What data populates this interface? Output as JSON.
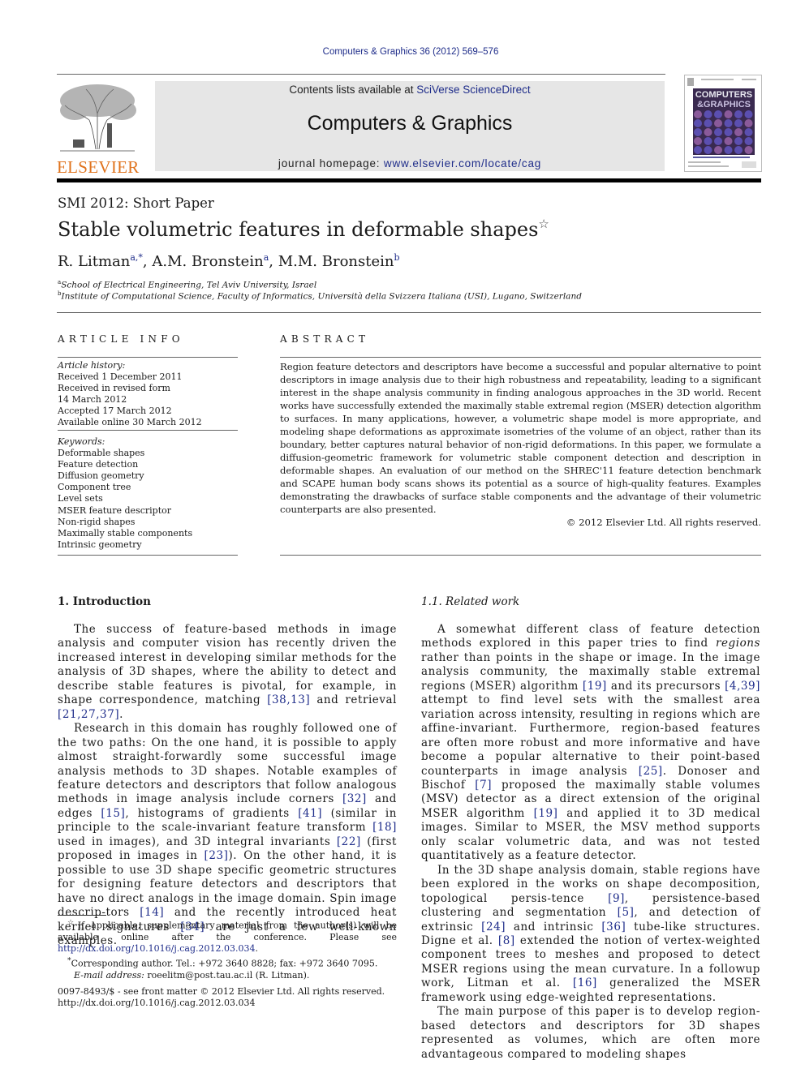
{
  "header": {
    "journal_ref": "Computers & Graphics 36 (2012) 569–576",
    "contents_prefix": "Contents lists available at ",
    "contents_link": "SciVerse ScienceDirect",
    "journal_title": "Computers & Graphics",
    "homepage_prefix": "journal homepage: ",
    "homepage_link": "www.elsevier.com/locate/cag",
    "publisher_logo_text": "ELSEVIER",
    "cover_title_line1": "COMPUTERS",
    "cover_title_line2": "&GRAPHICS",
    "colors": {
      "link": "#1f2d8a",
      "elsevier_orange": "#e0731d",
      "banner_bg": "#e6e6e6"
    }
  },
  "paper": {
    "section_label": "SMI 2012: Short Paper",
    "title": "Stable volumetric features in deformable shapes",
    "title_note_mark": "☆",
    "authors": [
      {
        "name": "R. Litman",
        "sup": "a,*"
      },
      {
        "name": "A.M. Bronstein",
        "sup": "a"
      },
      {
        "name": "M.M. Bronstein",
        "sup": "b"
      }
    ],
    "affiliations": [
      {
        "mark": "a",
        "text": "School of Electrical Engineering, Tel Aviv University, Israel"
      },
      {
        "mark": "b",
        "text": "Institute of Computational Science, Faculty of Informatics, Università della Svizzera Italiana (USI), Lugano, Switzerland"
      }
    ]
  },
  "article_info": {
    "heading": "ARTICLE INFO",
    "history_label": "Article history:",
    "history": [
      "Received 1 December 2011",
      "Received in revised form",
      "14 March 2012",
      "Accepted 17 March 2012",
      "Available online 30 March 2012"
    ],
    "keywords_label": "Keywords:",
    "keywords": [
      "Deformable shapes",
      "Feature detection",
      "Diffusion geometry",
      "Component tree",
      "Level sets",
      "MSER feature descriptor",
      "Non-rigid shapes",
      "Maximally stable components",
      "Intrinsic geometry"
    ]
  },
  "abstract": {
    "heading": "ABSTRACT",
    "text": "Region feature detectors and descriptors have become a successful and popular alternative to point descriptors in image analysis due to their high robustness and repeatability, leading to a significant interest in the shape analysis community in finding analogous approaches in the 3D world. Recent works have successfully extended the maximally stable extremal region (MSER) detection algorithm to surfaces. In many applications, however, a volumetric shape model is more appropriate, and modeling shape deformations as approximate isometries of the volume of an object, rather than its boundary, better captures natural behavior of non-rigid deformations. In this paper, we formulate a diffusion-geometric framework for volumetric stable component detection and description in deformable shapes. An evaluation of our method on the SHREC'11 feature detection benchmark and SCAPE human body scans shows its potential as a source of high-quality features. Examples demonstrating the drawbacks of surface stable components and the advantage of their volumetric counterparts are also presented.",
    "copyright": "© 2012 Elsevier Ltd. All rights reserved."
  },
  "introduction": {
    "heading": "1.  Introduction",
    "p1": [
      {
        "t": "The success of feature-based methods in image analysis and computer vision has recently driven the increased interest in developing similar methods for the analysis of 3D shapes, where the ability to detect and describe stable features is pivotal, for example, in shape correspondence, matching "
      },
      {
        "ref": "[38,13]"
      },
      {
        "t": " and retrieval "
      },
      {
        "ref": "[21,27,37]"
      },
      {
        "t": "."
      }
    ],
    "p2": [
      {
        "t": "Research in this domain has roughly followed one of the two paths: On the one hand, it is possible to apply almost straight-forwardly some successful image analysis methods to 3D shapes. Notable examples of feature detectors and descriptors that follow analogous methods in image analysis include corners "
      },
      {
        "ref": "[32]"
      },
      {
        "t": " and edges "
      },
      {
        "ref": "[15]"
      },
      {
        "t": ", histograms of gradients "
      },
      {
        "ref": "[41]"
      },
      {
        "t": " (similar in principle to the scale-invariant feature transform "
      },
      {
        "ref": "[18]"
      },
      {
        "t": " used in images), and 3D integral invariants "
      },
      {
        "ref": "[22]"
      },
      {
        "t": " (first proposed in images in "
      },
      {
        "ref": "[23]"
      },
      {
        "t": "). On the other hand, it is possible to use 3D shape specific geometric structures for designing feature detectors and descriptors that have no direct analogs in the image domain. Spin image descrip-tors "
      },
      {
        "ref": "[14]"
      },
      {
        "t": " and the recently introduced heat kernel signatures "
      },
      {
        "ref": "[34]"
      },
      {
        "t": " are just a few well-known examples."
      }
    ]
  },
  "related_work": {
    "heading": "1.1.  Related work",
    "p1": [
      {
        "t": "A somewhat different class of feature detection methods explored in this paper tries to find "
      },
      {
        "em": "regions"
      },
      {
        "t": " rather than points in the shape or image. In the image analysis community, the maximally stable extremal regions (MSER) algorithm "
      },
      {
        "ref": "[19]"
      },
      {
        "t": " and its precursors "
      },
      {
        "ref": "[4,39]"
      },
      {
        "t": " attempt to find level sets with the smallest area variation across intensity, resulting in regions which are affine-invariant. Furthermore, region-based features are often more robust and more informative and have become a popular alternative to their point-based counterparts in image analysis "
      },
      {
        "ref": "[25]"
      },
      {
        "t": ". Donoser and Bischof "
      },
      {
        "ref": "[7]"
      },
      {
        "t": " proposed the maximally stable volumes (MSV) detector as a direct extension of the original MSER algorithm "
      },
      {
        "ref": "[19]"
      },
      {
        "t": " and applied it to 3D medical images. Similar to MSER, the MSV method supports only scalar volumetric data, and was not tested quantitatively as a feature detector."
      }
    ],
    "p2": [
      {
        "t": "In the 3D shape analysis domain, stable regions have been explored in the works on shape decomposition, topological persis-tence "
      },
      {
        "ref": "[9]"
      },
      {
        "t": ", persistence-based clustering and segmentation "
      },
      {
        "ref": "[5]"
      },
      {
        "t": ", and detection of extrinsic "
      },
      {
        "ref": "[24]"
      },
      {
        "t": " and intrinsic "
      },
      {
        "ref": "[36]"
      },
      {
        "t": " tube-like structures. Digne et al. "
      },
      {
        "ref": "[8]"
      },
      {
        "t": " extended the notion of vertex-weighted component trees to meshes and proposed to detect MSER regions using the mean curvature. In a followup work, Litman et al. "
      },
      {
        "ref": "[16]"
      },
      {
        "t": " generalized the MSER framework using edge-weighted representations."
      }
    ],
    "p3": [
      {
        "t": "The main purpose of this paper is to develop region-based detectors and descriptors for 3D shapes represented as volumes, which are often more advantageous compared to modeling shapes"
      }
    ]
  },
  "footnotes": {
    "star_mark": "☆",
    "star_text": "If applicable, supplementary material from the author(s) will be available online after the conference. Please see ",
    "star_link": "http://dx.doi.org/10.1016/j.cag.2012.03.034",
    "star_end": ".",
    "corresponding_mark": "*",
    "corresponding_text": "Corresponding author. Tel.: +972 3640 8828; fax: +972 3640 7095.",
    "email_label": "E-mail address:",
    "email_value": " roeelitm@post.tau.ac.il (R. Litman)."
  },
  "front_matter": {
    "line1": "0097-8493/$ - see front matter © 2012 Elsevier Ltd. All rights reserved.",
    "line2": "http://dx.doi.org/10.1016/j.cag.2012.03.034"
  }
}
